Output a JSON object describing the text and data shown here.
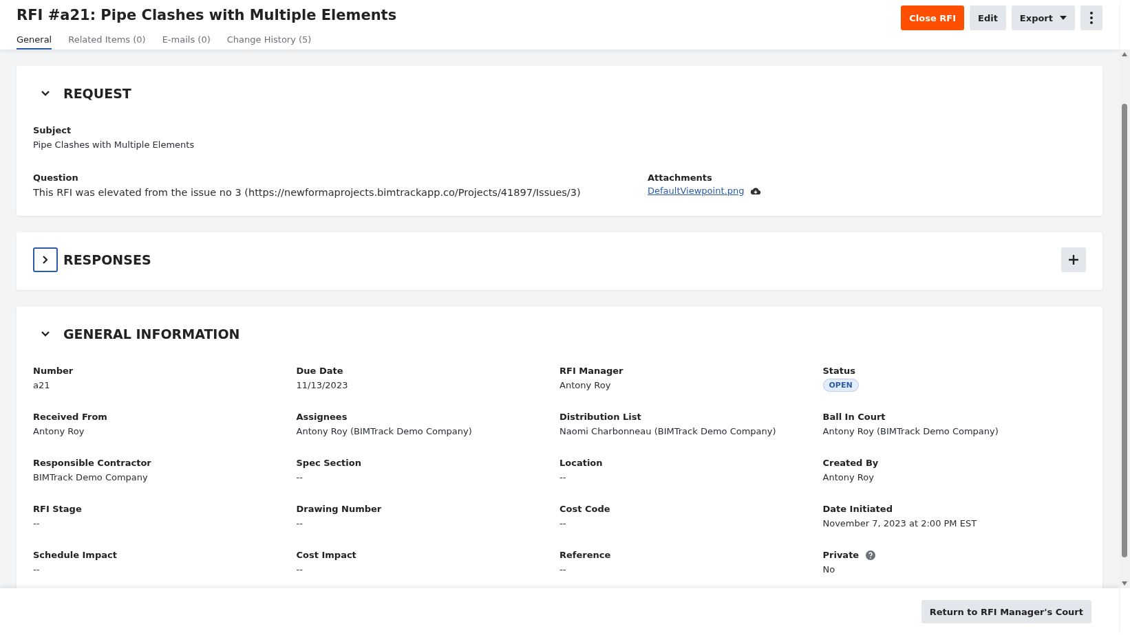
{
  "header": {
    "title": "RFI #a21: Pipe Clashes with Multiple Elements",
    "actions": [
      {
        "label": "Close RFI",
        "kind": "primary"
      },
      {
        "label": "Edit",
        "kind": "secondary"
      },
      {
        "label": "Export",
        "kind": "dropdown"
      },
      {
        "kind": "more"
      }
    ],
    "tabs": [
      {
        "label": "General",
        "selected": true
      },
      {
        "label": "Related Items (0)",
        "selected": false
      },
      {
        "label": "E-mails (0)",
        "selected": false
      },
      {
        "label": "Change History (5)",
        "selected": false
      }
    ]
  },
  "sections": [
    {
      "title": "REQUEST",
      "expanded": true,
      "focused": false,
      "add_button": false,
      "kind": "request",
      "fields": [
        {
          "label": "Subject",
          "value": "Pipe Clashes with Multiple Elements",
          "kind": "text"
        },
        {
          "label": "Question",
          "value": "This RFI was elevated from the issue no 3 (https://newformaprojects.bimtrackapp.co/Projects/41897/Issues/3)",
          "kind": "text"
        },
        {
          "label": "Attachments",
          "value": "DefaultViewpoint.png",
          "kind": "attachment"
        }
      ]
    },
    {
      "title": "RESPONSES",
      "expanded": false,
      "focused": true,
      "add_button": true
    },
    {
      "title": "GENERAL INFORMATION",
      "expanded": true,
      "focused": false,
      "add_button": false,
      "kind": "grid",
      "fields": [
        {
          "label": "Number",
          "value": "a21",
          "kind": "text"
        },
        {
          "label": "Due Date",
          "value": "11/13/2023",
          "kind": "text"
        },
        {
          "label": "RFI Manager",
          "value": "Antony Roy",
          "kind": "text"
        },
        {
          "label": "Status",
          "value": "OPEN",
          "kind": "badge"
        },
        {
          "label": "Received From",
          "value": "Antony Roy",
          "kind": "text"
        },
        {
          "label": "Assignees",
          "value": "Antony Roy (BIMTrack Demo Company)",
          "kind": "text"
        },
        {
          "label": "Distribution List",
          "value": "Naomi Charbonneau (BIMTrack Demo Company)",
          "kind": "text"
        },
        {
          "label": "Ball In Court",
          "value": "Antony Roy (BIMTrack Demo Company)",
          "kind": "text"
        },
        {
          "label": "Responsible Contractor",
          "value": "BIMTrack Demo Company",
          "kind": "text"
        },
        {
          "label": "Spec Section",
          "value": "--",
          "kind": "text"
        },
        {
          "label": "Location",
          "value": "--",
          "kind": "text"
        },
        {
          "label": "Created By",
          "value": "Antony Roy",
          "kind": "text"
        },
        {
          "label": "RFI Stage",
          "value": "--",
          "kind": "text"
        },
        {
          "label": "Drawing Number",
          "value": "--",
          "kind": "text"
        },
        {
          "label": "Cost Code",
          "value": "--",
          "kind": "text"
        },
        {
          "label": "Date Initiated",
          "value": "November 7, 2023 at 2:00 PM EST",
          "kind": "text"
        },
        {
          "label": "Schedule Impact",
          "value": "--",
          "kind": "text"
        },
        {
          "label": "Cost Impact",
          "value": "--",
          "kind": "text"
        },
        {
          "label": "Reference",
          "value": "--",
          "kind": "text"
        },
        {
          "label": "Private",
          "value": "No",
          "kind": "help"
        }
      ]
    }
  ],
  "footer": {
    "button": "Return to RFI Manager's Court"
  }
}
